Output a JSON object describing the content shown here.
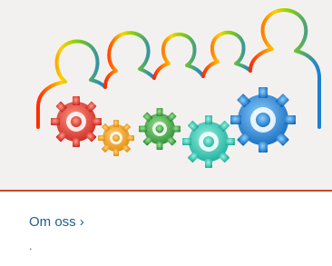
{
  "card": {
    "image": {
      "alt_icon": "team-gears-illustration",
      "colors": {
        "outline_left": "#ff2a00",
        "outline_mid": "#8ad400",
        "outline_right": "#1a7fd8",
        "gear_red": "#e5352b",
        "gear_orange": "#f29a1a",
        "gear_green": "#3aa544",
        "gear_teal": "#21c7b0",
        "gear_blue": "#0d7fd9"
      }
    },
    "divider_color": "#c8461f",
    "link_label": "Om oss",
    "link_chevron": "›",
    "footnote": "."
  }
}
